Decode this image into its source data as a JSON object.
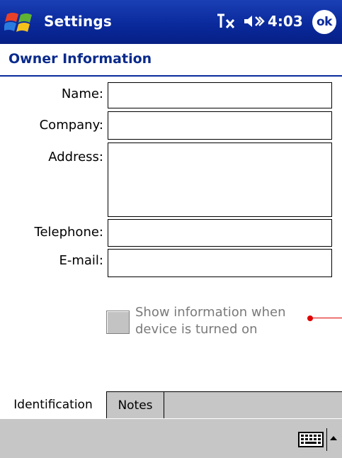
{
  "titlebar": {
    "start_icon": "windows-flag-icon",
    "title": "Settings",
    "connectivity_icon": "connectivity-off-icon",
    "volume_icon": "speaker-icon",
    "time": "4:03",
    "ok_label": "ok"
  },
  "page": {
    "heading": "Owner Information"
  },
  "form": {
    "name_label": "Name:",
    "name_value": "",
    "company_label": "Company:",
    "company_value": "",
    "address_label": "Address:",
    "address_value": "",
    "telephone_label": "Telephone:",
    "telephone_value": "",
    "email_label": "E-mail:",
    "email_value": "",
    "show_info_label": "Show information when device is turned on",
    "show_info_checked": false
  },
  "tabs": [
    {
      "label": "Identification",
      "active": true
    },
    {
      "label": "Notes",
      "active": false
    }
  ],
  "menubar": {
    "keyboard_icon": "keyboard-icon",
    "sip_arrow_icon": "up-arrow-icon"
  },
  "colors": {
    "titlebar": "#0a2a9c",
    "heading": "#0a2a8c",
    "bar_gray": "#c6c6c6",
    "callout": "#e00000"
  }
}
